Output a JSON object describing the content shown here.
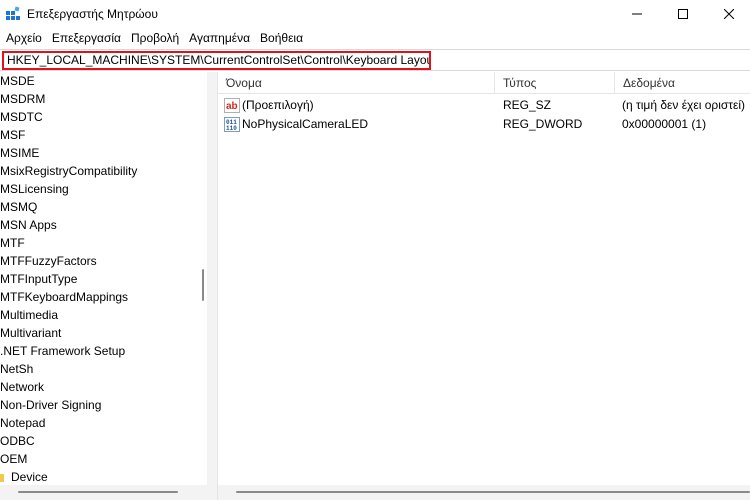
{
  "window": {
    "title": "Επεξεργαστής Μητρώου"
  },
  "menu": [
    "Αρχείο",
    "Επεξεργασία",
    "Προβολή",
    "Αγαπημένα",
    "Βοήθεια"
  ],
  "address": {
    "path": "HKEY_LOCAL_MACHINE\\SYSTEM\\CurrentControlSet\\Control\\Keyboard Layout"
  },
  "tree": {
    "items": [
      "MSDE",
      "MSDRM",
      "MSDTC",
      "MSF",
      "MSIME",
      "MsixRegistryCompatibility",
      "MSLicensing",
      "MSMQ",
      "MSN Apps",
      "MTF",
      "MTFFuzzyFactors",
      "MTFInputType",
      "MTFKeyboardMappings",
      "Multimedia",
      "Multivariant",
      ".NET Framework Setup",
      "NetSh",
      "Network",
      "Non-Driver Signing",
      "Notepad",
      "ODBC",
      "OEM"
    ],
    "child": "Device"
  },
  "columns": {
    "name": "Όνομα",
    "type": "Τύπος",
    "data": "Δεδομένα"
  },
  "values": [
    {
      "icon": "string-value-icon",
      "name": "(Προεπιλογή)",
      "type": "REG_SZ",
      "data": "(η τιμή δεν έχει οριστεί)"
    },
    {
      "icon": "binary-value-icon",
      "name": "NoPhysicalCameraLED",
      "type": "REG_DWORD",
      "data": "0x00000001 (1)"
    }
  ],
  "colors": {
    "highlight_border": "#e0131b",
    "folder": "#f2c94c"
  }
}
